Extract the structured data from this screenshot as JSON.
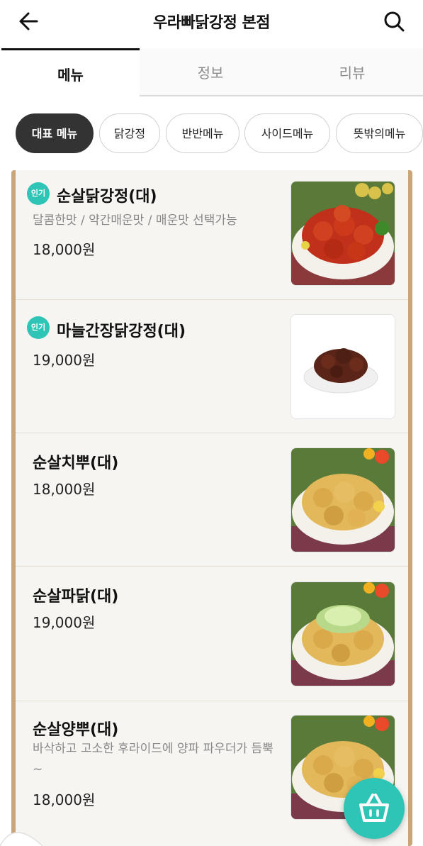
{
  "header": {
    "title": "우라빠닭강정 본점",
    "back_icon": "arrow-left-icon",
    "search_icon": "search-icon"
  },
  "tabs": [
    {
      "label": "메뉴",
      "active": true
    },
    {
      "label": "정보",
      "active": false
    },
    {
      "label": "리뷰",
      "active": false
    }
  ],
  "categories": [
    {
      "label": "대표 메뉴",
      "active": true
    },
    {
      "label": "닭강정",
      "active": false
    },
    {
      "label": "반반메뉴",
      "active": false
    },
    {
      "label": "사이드메뉴",
      "active": false
    },
    {
      "label": "뜻밖의메뉴",
      "active": false
    }
  ],
  "menu_items": [
    {
      "name": "순살닭강정(대)",
      "badge": "인기",
      "desc": "달콤한맛 / 약간매운맛 / 매운맛 선택가능",
      "price": "18,000원"
    },
    {
      "name": "마늘간장닭강정(대)",
      "badge": "인기",
      "desc": "",
      "price": "19,000원"
    },
    {
      "name": "순살치뿌(대)",
      "badge": "",
      "desc": "",
      "price": "18,000원"
    },
    {
      "name": "순살파닭(대)",
      "badge": "",
      "desc": "",
      "price": "19,000원"
    },
    {
      "name": "순살양뿌(대)",
      "badge": "",
      "desc": "바삭하고 고소한 후라이드에 양파 파우더가 듬뿍~",
      "price": "18,000원"
    }
  ],
  "cart": {
    "icon": "basket-icon"
  },
  "colors": {
    "accent": "#2ec4b6",
    "frame": "#c8a57a",
    "chip_active": "#333333"
  }
}
